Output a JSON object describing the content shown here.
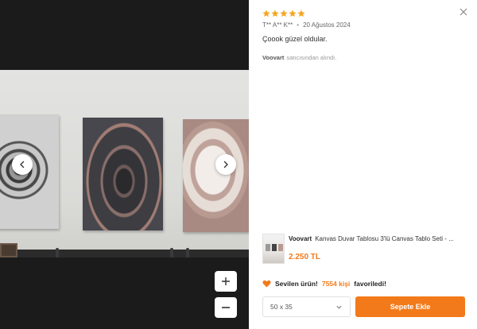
{
  "review": {
    "rating": 5,
    "max_rating": 5,
    "star_color": "#f5a623",
    "author": "T** A** K**",
    "separator": "•",
    "date": "20 Ağustos 2024",
    "comment": "Çoook güzel oldular.",
    "seller_name": "Voovart",
    "seller_suffix": "satıcısından alındı."
  },
  "product": {
    "brand": "Voovart",
    "title": "Kanvas Duvar Tablosu 3'lü Canvas Tablo Seti - ...",
    "price": "2.250 TL"
  },
  "favorite": {
    "prefix": "Sevilen ürün!",
    "count_text": "7554 kişi",
    "suffix": "favoriledi!",
    "icon_color": "#f27a1a"
  },
  "size_select": {
    "value": "50 x 35"
  },
  "actions": {
    "add_to_cart": "Sepete Ekle"
  },
  "colors": {
    "accent": "#f27a1a",
    "viewer_background": "#1b1b1b"
  },
  "icons": {
    "prev": "chevron-left-icon",
    "next": "chevron-right-icon",
    "zoom_in": "plus-icon",
    "zoom_out": "minus-icon",
    "close": "close-icon",
    "favorite": "heart-icon",
    "dropdown": "chevron-down-icon",
    "rating": "star-icon"
  }
}
